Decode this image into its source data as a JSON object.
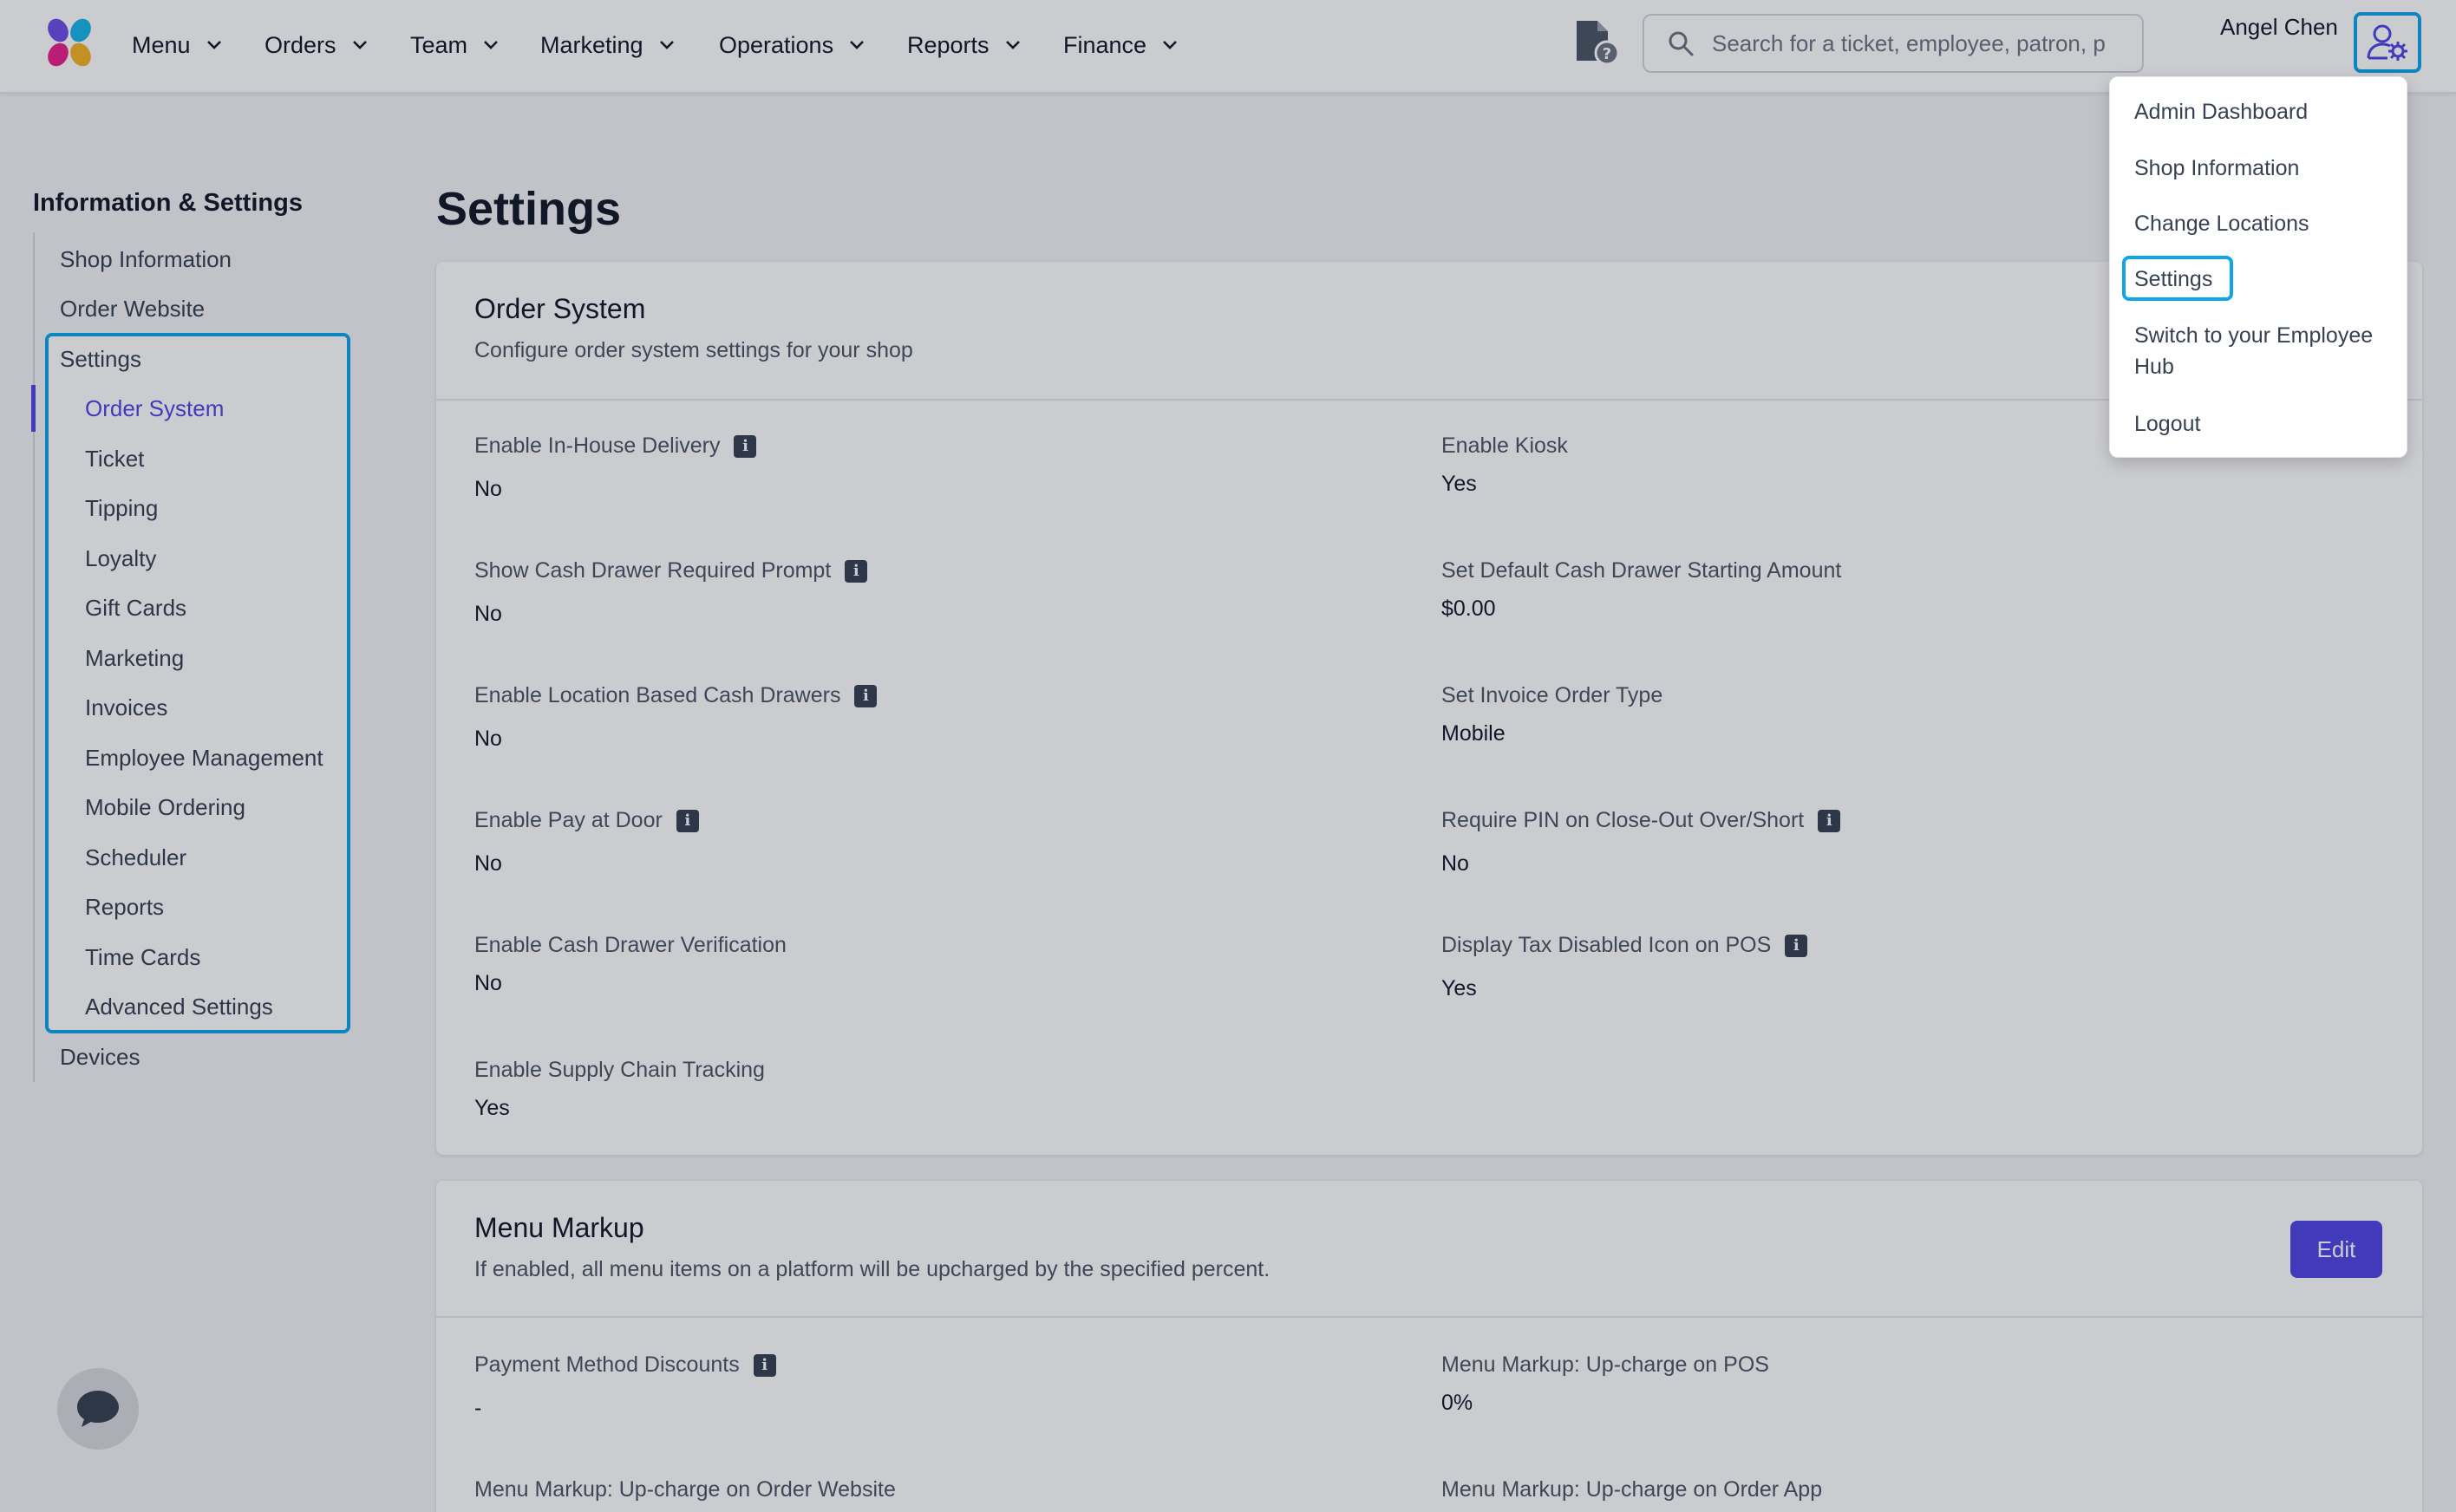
{
  "brand": {
    "accent": "#4f46e5",
    "highlight": "#0ea5e9",
    "logo_icon": "pinwheel-logo-icon"
  },
  "nav": {
    "items": [
      {
        "label": "Menu"
      },
      {
        "label": "Orders"
      },
      {
        "label": "Team"
      },
      {
        "label": "Marketing"
      },
      {
        "label": "Operations"
      },
      {
        "label": "Reports"
      },
      {
        "label": "Finance"
      }
    ]
  },
  "search": {
    "placeholder": "Search for a ticket, employee, patron, p"
  },
  "user": {
    "name": "Angel Chen"
  },
  "user_menu": {
    "items": [
      "Admin Dashboard",
      "Shop Information",
      "Change Locations",
      "Settings",
      "Switch to your Employee Hub",
      "Logout"
    ],
    "active": "Settings"
  },
  "sidebar": {
    "title": "Information & Settings",
    "links": [
      "Shop Information",
      "Order Website",
      "Settings",
      "Devices"
    ],
    "settings_children": [
      "Order System",
      "Ticket",
      "Tipping",
      "Loyalty",
      "Gift Cards",
      "Marketing",
      "Invoices",
      "Employee Management",
      "Mobile Ordering",
      "Scheduler",
      "Reports",
      "Time Cards",
      "Advanced Settings"
    ],
    "active_child": "Order System"
  },
  "page": {
    "title": "Settings"
  },
  "order_system": {
    "title": "Order System",
    "description": "Configure order system settings for your shop",
    "fields": [
      {
        "label": "Enable In-House Delivery",
        "value": "No",
        "info": true
      },
      {
        "label": "Enable Kiosk",
        "value": "Yes",
        "info": false
      },
      {
        "label": "Show Cash Drawer Required Prompt",
        "value": "No",
        "info": true
      },
      {
        "label": "Set Default Cash Drawer Starting Amount",
        "value": "$0.00",
        "info": false
      },
      {
        "label": "Enable Location Based Cash Drawers",
        "value": "No",
        "info": true
      },
      {
        "label": "Set Invoice Order Type",
        "value": "Mobile",
        "info": false
      },
      {
        "label": "Enable Pay at Door",
        "value": "No",
        "info": true
      },
      {
        "label": "Require PIN on Close-Out Over/Short",
        "value": "No",
        "info": true
      },
      {
        "label": "Enable Cash Drawer Verification",
        "value": "No",
        "info": false
      },
      {
        "label": "Display Tax Disabled Icon on POS",
        "value": "Yes",
        "info": true
      },
      {
        "label": "Enable Supply Chain Tracking",
        "value": "Yes",
        "info": false
      }
    ]
  },
  "menu_markup": {
    "title": "Menu Markup",
    "description": "If enabled, all menu items on a platform will be upcharged by the specified percent.",
    "edit_label": "Edit",
    "fields": [
      {
        "label": "Payment Method Discounts",
        "value": "-",
        "info": true
      },
      {
        "label": "Menu Markup: Up-charge on POS",
        "value": "0%",
        "info": false
      },
      {
        "label": "Menu Markup: Up-charge on Order Website",
        "value": "",
        "info": false
      },
      {
        "label": "Menu Markup: Up-charge on Order App",
        "value": "",
        "info": false
      }
    ]
  },
  "info_glyph": "i"
}
